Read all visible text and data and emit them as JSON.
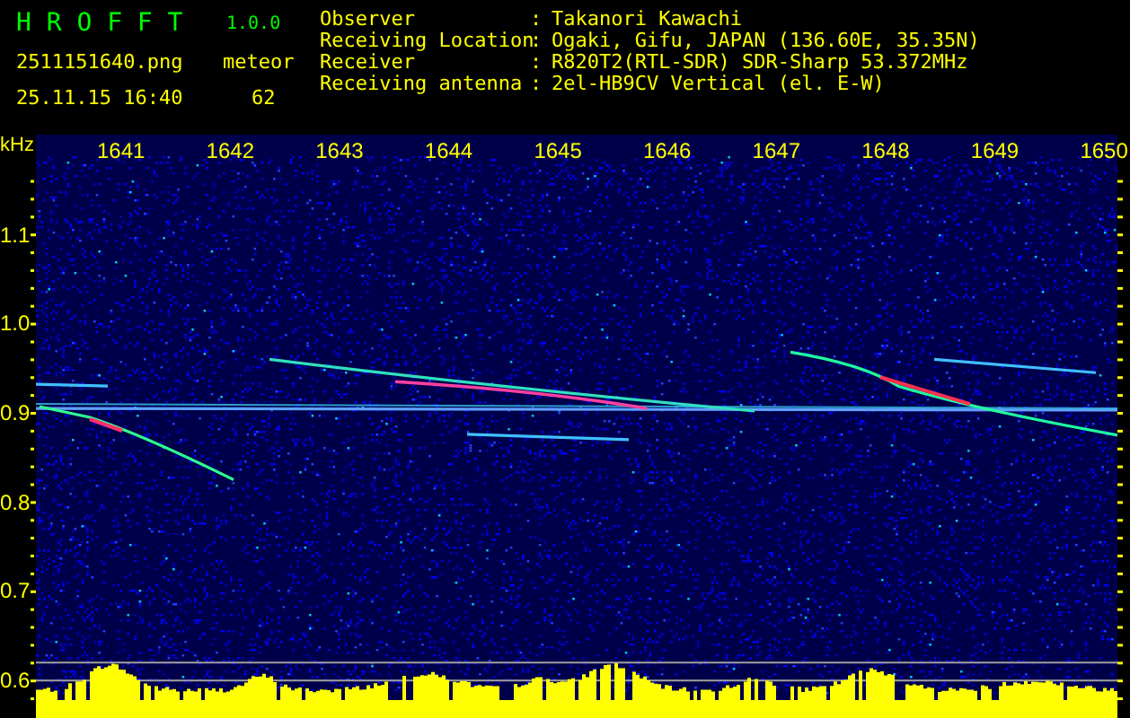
{
  "header": {
    "app_name": "H R O F F T",
    "version": "1.0.0",
    "file_name": "2511151640.png",
    "date_time": "25.11.15 16:40",
    "meteor_label": "meteor",
    "meteor_count": "62"
  },
  "info": [
    {
      "label": "Observer",
      "separator": ":",
      "value": "Takanori Kawachi"
    },
    {
      "label": "Receiving Location",
      "separator": ":",
      "value": "Ogaki, Gifu, JAPAN (136.60E, 35.35N)"
    },
    {
      "label": "Receiver",
      "separator": ":",
      "value": "R820T2(RTL-SDR) SDR-Sharp 53.372MHz"
    },
    {
      "label": "Receiving antenna",
      "separator": ":",
      "value": "2el-HB9CV Vertical (el. E-W)"
    }
  ],
  "axis": {
    "unit": "kHz",
    "y_labels": [
      "1.1",
      "1.0",
      "0.9",
      "0.8",
      "0.7",
      "0.6"
    ],
    "time_labels": [
      "1641",
      "1642",
      "1643",
      "1644",
      "1645",
      "1646",
      "1647",
      "1648",
      "1649",
      "1650"
    ]
  }
}
